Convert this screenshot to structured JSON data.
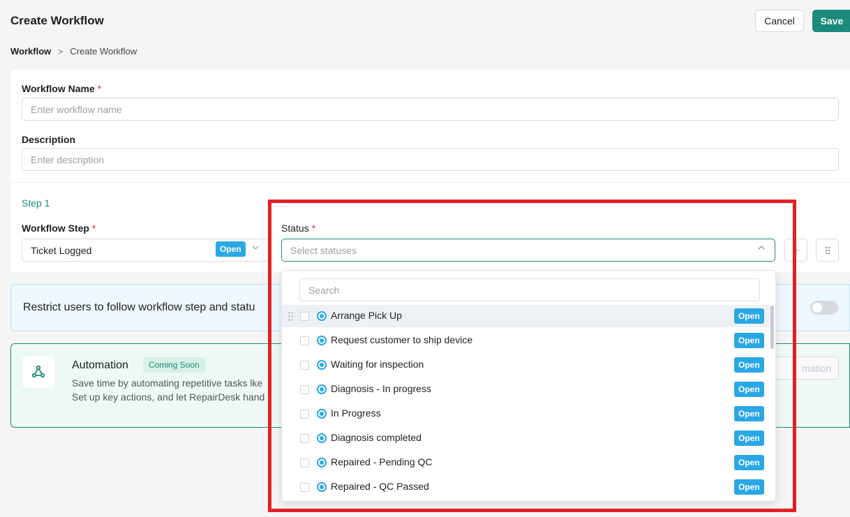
{
  "header": {
    "title": "Create Workflow",
    "cancel_label": "Cancel",
    "save_label": "Save"
  },
  "breadcrumb": {
    "root": "Workflow",
    "separator": ">",
    "current": "Create Workflow"
  },
  "form": {
    "name_label": "Workflow Name",
    "name_placeholder": "Enter workflow name",
    "desc_label": "Description",
    "desc_placeholder": "Enter description",
    "required_mark": "*"
  },
  "step": {
    "title": "Step 1",
    "workflow_step_label": "Workflow Step",
    "workflow_step_value": "Ticket Logged",
    "workflow_step_badge": "Open",
    "status_label": "Status",
    "status_placeholder": "Select statuses"
  },
  "restrict": {
    "text": "Restrict users to follow workflow step and statu",
    "toggle_on": false
  },
  "automation": {
    "title": "Automation",
    "badge": "Coming Soon",
    "line1": "Save time by automating repetitive tasks lke",
    "line2": "Set up key actions, and let RepairDesk hand",
    "button": "mation"
  },
  "dropdown": {
    "search_placeholder": "Search",
    "items": [
      {
        "label": "Arrange Pick Up",
        "badge": "Open"
      },
      {
        "label": "Request customer to ship device",
        "badge": "Open"
      },
      {
        "label": "Waiting for inspection",
        "badge": "Open"
      },
      {
        "label": "Diagnosis - In progress",
        "badge": "Open"
      },
      {
        "label": "In Progress",
        "badge": "Open"
      },
      {
        "label": "Diagnosis completed",
        "badge": "Open"
      },
      {
        "label": "Repaired - Pending QC",
        "badge": "Open"
      },
      {
        "label": "Repaired - QC Passed",
        "badge": "Open"
      }
    ]
  },
  "colors": {
    "accent": "#1a8a7a",
    "badge_blue": "#2aa7e6",
    "highlight": "#e32024"
  }
}
